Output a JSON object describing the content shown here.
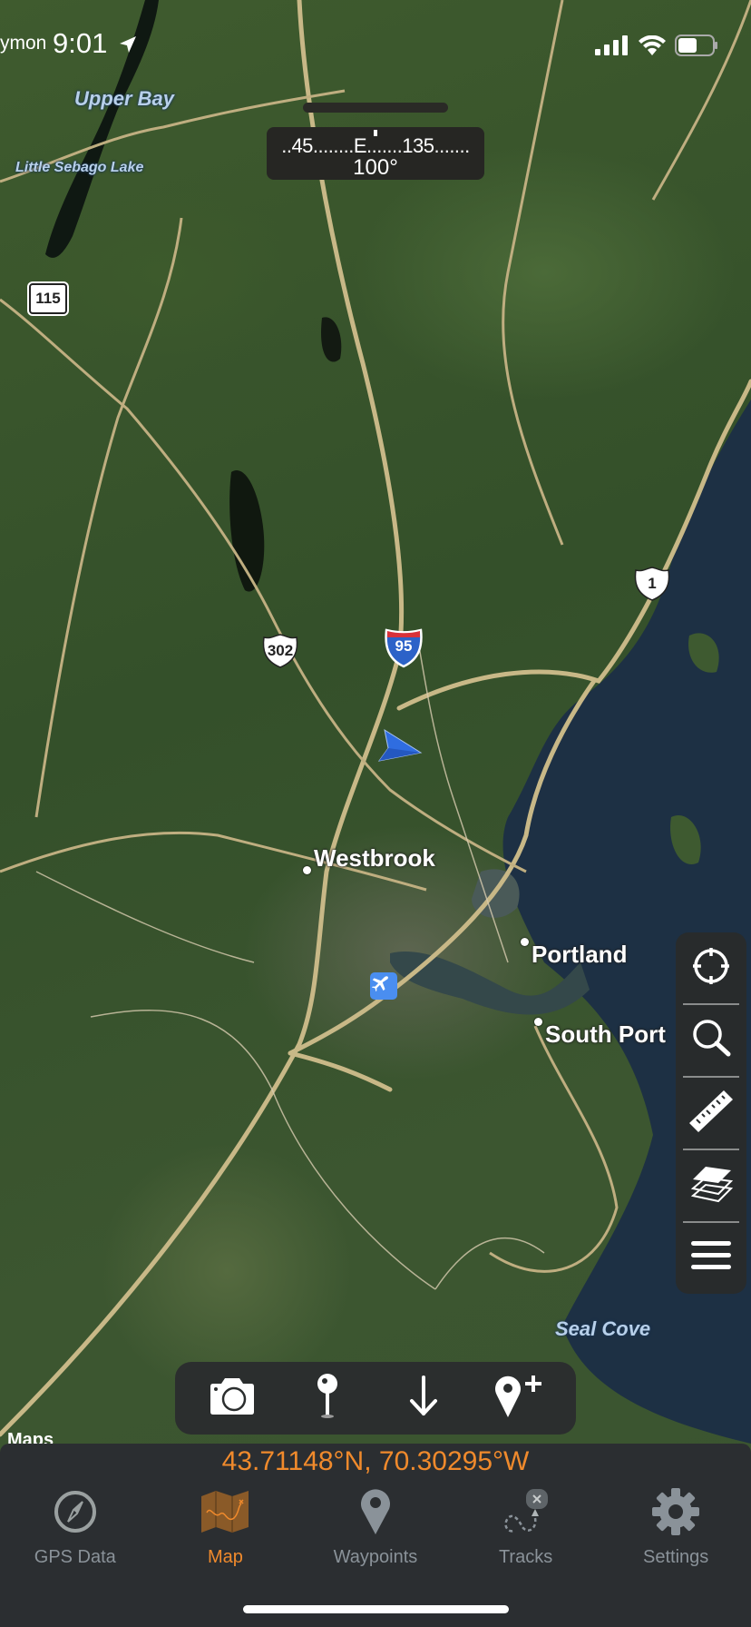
{
  "status_bar": {
    "carrier_fragment": "ymon",
    "time": "9:01",
    "location_icon": "location-arrow-icon",
    "signal_icon": "cellular-signal-icon",
    "wifi_icon": "wifi-icon",
    "battery_icon": "battery-icon"
  },
  "compass": {
    "scale": "..45........E.......135.......",
    "heading": "100°"
  },
  "map": {
    "water_labels": [
      "Upper Bay",
      "Little Sebago Lake",
      "Seal Cove"
    ],
    "places": [
      "Westbrook",
      "Portland",
      "South Port"
    ],
    "route_shields": {
      "state_115": "115",
      "us_302": "302",
      "us_1": "1",
      "interstate_95": "95"
    },
    "airport_icon": "airplane-icon",
    "user_heading_icon": "navigation-arrow-icon",
    "attribution": "Maps"
  },
  "map_tools": [
    {
      "name": "center-location",
      "icon": "crosshair-icon"
    },
    {
      "name": "search",
      "icon": "search-icon"
    },
    {
      "name": "measure",
      "icon": "ruler-icon"
    },
    {
      "name": "layers",
      "icon": "layers-icon"
    },
    {
      "name": "menu",
      "icon": "menu-icon"
    }
  ],
  "action_bar": [
    {
      "name": "camera",
      "icon": "camera-icon"
    },
    {
      "name": "drop-pin",
      "icon": "pin-icon"
    },
    {
      "name": "download",
      "icon": "arrow-down-icon"
    },
    {
      "name": "add-waypoint",
      "icon": "add-location-icon"
    }
  ],
  "coordinates": "43.71148°N, 70.30295°W",
  "tabs": [
    {
      "label": "GPS Data",
      "icon": "compass-icon",
      "active": false
    },
    {
      "label": "Map",
      "icon": "map-icon",
      "active": true
    },
    {
      "label": "Waypoints",
      "icon": "waypoint-pin-icon",
      "active": false
    },
    {
      "label": "Tracks",
      "icon": "tracks-icon",
      "active": false
    },
    {
      "label": "Settings",
      "icon": "gear-icon",
      "active": false
    }
  ],
  "colors": {
    "accent": "#f08a2c",
    "inactive": "#8a9299",
    "panel": "#2b2e31"
  }
}
